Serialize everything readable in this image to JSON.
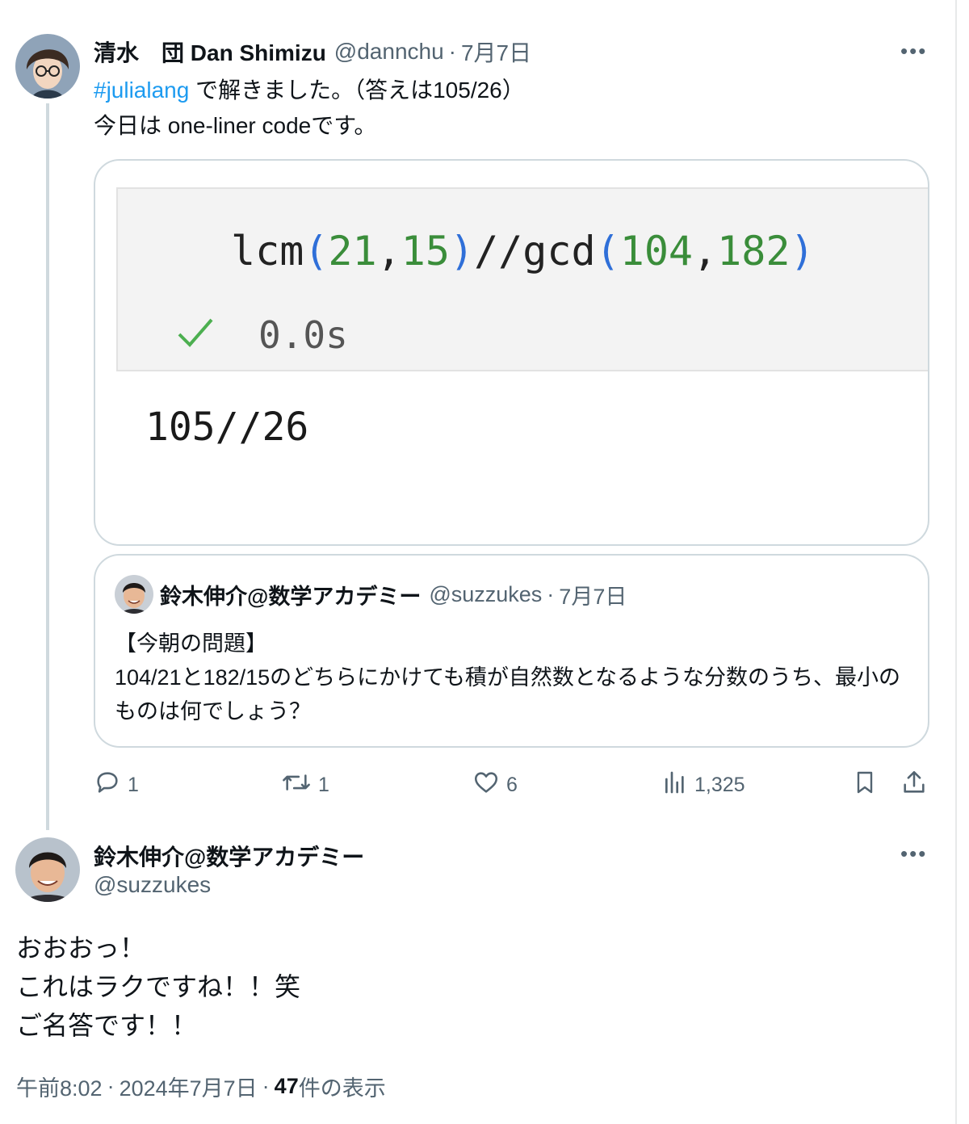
{
  "tweet1": {
    "display_name": "清水　団 Dan Shimizu",
    "handle": "@dannchu",
    "separator": "·",
    "date": "7月7日",
    "more_label": "•••",
    "hashtag": "#julialang",
    "line1_rest": " で解きました。（答えは105/26）",
    "line2": "今日は one-liner codeです。",
    "media": {
      "code_fn1": "lcm",
      "code_open1": "(",
      "code_arg1a": "21",
      "code_comma1": ",",
      "code_arg1b": "15",
      "code_close1": ")",
      "code_op": "//",
      "code_fn2": "gcd",
      "code_open2": "(",
      "code_arg2a": "104",
      "code_comma2": ",",
      "code_arg2b": "182",
      "code_close2": ")",
      "exec_time": "0.0s",
      "output": "105//26"
    },
    "quote": {
      "display_name": "鈴木伸介@数学アカデミー",
      "handle": "@suzzukes",
      "separator": "·",
      "date": "7月7日",
      "text_line1": "【今朝の問題】",
      "text_line2": "104/21と182/15のどちらにかけても積が自然数となるような分数のうち、最小のものは何でしょう？"
    },
    "actions": {
      "replies": "1",
      "retweets": "1",
      "likes": "6",
      "views": "1,325"
    }
  },
  "tweet2": {
    "display_name": "鈴木伸介@数学アカデミー",
    "handle": "@suzzukes",
    "more_label": "•••",
    "line1": "おおおっ！",
    "line2": "これはラクですね！！笑",
    "line3": "ご名答です！！",
    "time": "午前8:02",
    "separator": "·",
    "date": "2024年7月7日",
    "view_count": "47",
    "view_suffix": " 件の表示"
  },
  "colors": {
    "link": "#1d9bf0",
    "secondary_text": "#536471",
    "border": "#cfd9de",
    "code_number": "#3a8d3a",
    "code_paren": "#2f6fd8",
    "check": "#4caf50"
  }
}
